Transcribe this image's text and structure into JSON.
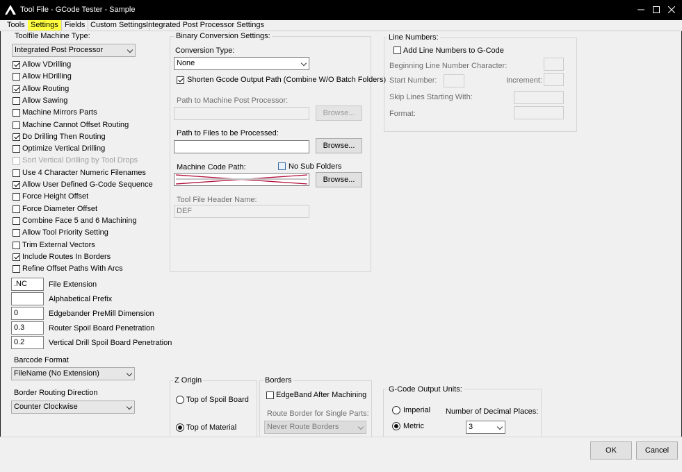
{
  "window": {
    "title": "Tool File - GCode Tester - Sample",
    "minimize_icon": "minimize-icon",
    "maximize_icon": "maximize-icon",
    "close_icon": "close-icon"
  },
  "tabs": [
    "Tools",
    "Settings",
    "Fields",
    "Custom Settings",
    "Integrated Post Processor Settings"
  ],
  "left": {
    "machine_type_label": "Toolfile Machine Type:",
    "machine_type_value": "Integrated Post Processor",
    "checkboxes": [
      {
        "label": "Allow VDrilling",
        "checked": true,
        "enabled": true
      },
      {
        "label": "Allow HDrilling",
        "checked": false,
        "enabled": true
      },
      {
        "label": "Allow Routing",
        "checked": true,
        "enabled": true
      },
      {
        "label": "Allow Sawing",
        "checked": false,
        "enabled": true
      },
      {
        "label": "Machine Mirrors Parts",
        "checked": false,
        "enabled": true
      },
      {
        "label": "Machine Cannot Offset Routing",
        "checked": false,
        "enabled": true
      },
      {
        "label": "Do Drilling Then Routing",
        "checked": true,
        "enabled": true
      },
      {
        "label": "Optimize Vertical Drilling",
        "checked": false,
        "enabled": true
      },
      {
        "label": "Sort Vertical Drilling by Tool Drops",
        "checked": false,
        "enabled": false
      },
      {
        "label": "Use 4 Character Numeric Filenames",
        "checked": false,
        "enabled": true
      },
      {
        "label": "Allow User Defined G-Code Sequence",
        "checked": true,
        "enabled": true
      },
      {
        "label": "Force Height Offset",
        "checked": false,
        "enabled": true
      },
      {
        "label": "Force Diameter Offset",
        "checked": false,
        "enabled": true
      },
      {
        "label": "Combine Face 5 and 6 Machining",
        "checked": false,
        "enabled": true
      },
      {
        "label": "Allow Tool Priority Setting",
        "checked": false,
        "enabled": true
      },
      {
        "label": "Trim External Vectors",
        "checked": false,
        "enabled": true
      },
      {
        "label": "Include Routes In Borders",
        "checked": true,
        "enabled": true
      },
      {
        "label": "Refine Offset Paths With Arcs",
        "checked": false,
        "enabled": true
      }
    ],
    "fields": [
      {
        "value": ".NC",
        "label": "File Extension"
      },
      {
        "value": "",
        "label": "Alphabetical Prefix"
      },
      {
        "value": "0",
        "label": "Edgebander PreMill Dimension"
      },
      {
        "value": "0.3",
        "label": "Router Spoil Board Penetration"
      },
      {
        "value": "0.2",
        "label": "Vertical Drill Spoil Board Penetration"
      }
    ],
    "barcode_label": "Barcode Format",
    "barcode_value": "FileName (No Extension)",
    "border_label": "Border Routing Direction",
    "border_value": "Counter Clockwise"
  },
  "binary": {
    "title": "Binary Conversion Settings:",
    "conversion_type_label": "Conversion Type:",
    "conversion_type_value": "None",
    "shorten_label": "Shorten Gcode Output Path (Combine W/O Batch Folders)",
    "shorten_checked": true,
    "post_processor_label": "Path to Machine Post Processor:",
    "post_processor_value": "",
    "browse_label": "Browse...",
    "files_label": "Path to Files to be Processed:",
    "files_value": "",
    "machine_code_label": "Machine Code Path:",
    "no_sub_folders_label": "No Sub Folders",
    "machine_code_value": "",
    "header_name_label": "Tool File Header Name:",
    "header_name_value": "DEF"
  },
  "line_numbers": {
    "title": "Line Numbers:",
    "add_label": "Add Line Numbers to G-Code",
    "beginning_label": "Beginning Line Number Character:",
    "start_label": "Start Number:",
    "increment_label": "Increment:",
    "skip_label": "Skip Lines Starting With:",
    "format_label": "Format:"
  },
  "z_origin": {
    "title": "Z Origin",
    "top_spoil_label": "Top of Spoil Board",
    "top_material_label": "Top of Material",
    "selected": "Top of Material"
  },
  "borders": {
    "title": "Borders",
    "edgeband_label": "EdgeBand After Machining",
    "route_border_label": "Route Border for Single Parts:",
    "route_border_value": "Never Route Borders"
  },
  "units": {
    "title": "G-Code Output Units:",
    "imperial_label": "Imperial",
    "metric_label": "Metric",
    "selected": "Metric",
    "decimal_label": "Number of Decimal Places:",
    "decimal_value": "3"
  },
  "footer": {
    "ok_label": "OK",
    "cancel_label": "Cancel"
  },
  "colors": {
    "title_bar": "#000000",
    "active_tab": "#ffff40",
    "error_strike": "#b0103a"
  }
}
